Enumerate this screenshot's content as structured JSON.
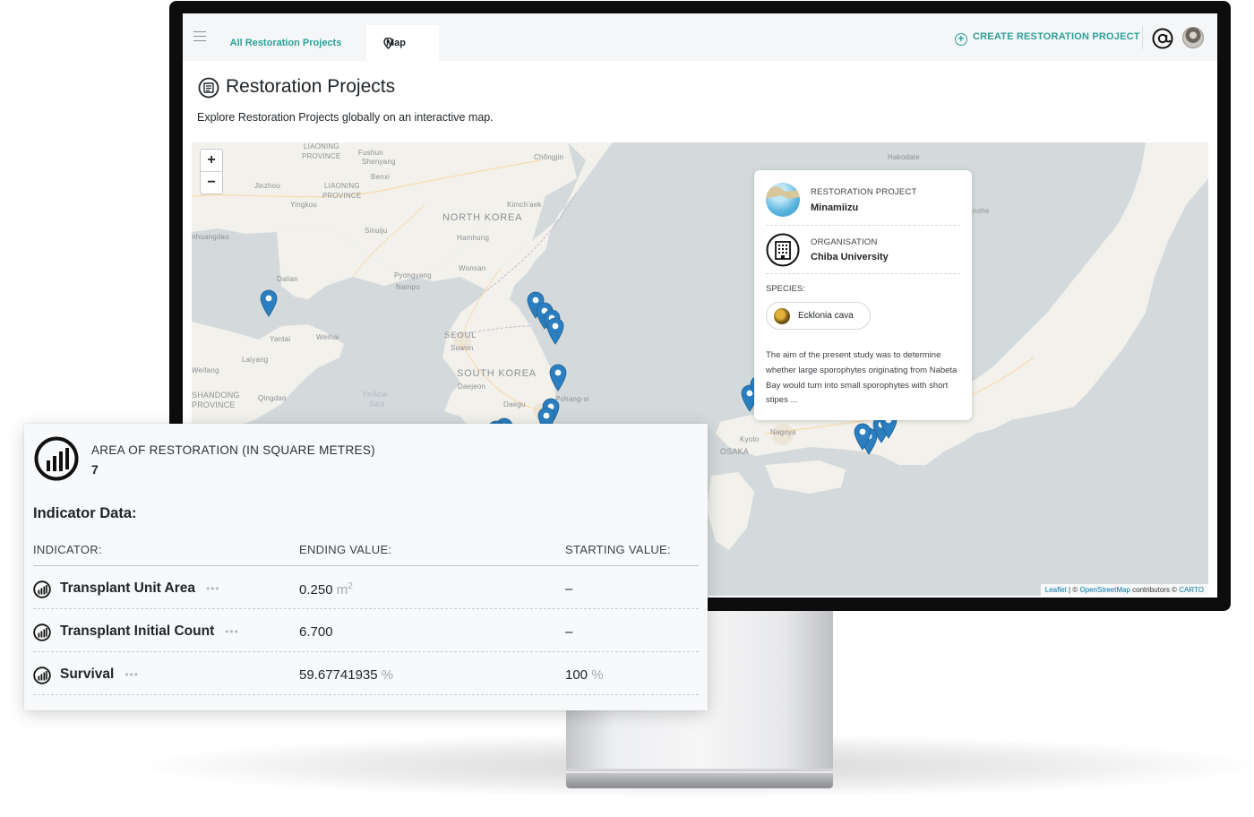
{
  "nav": {
    "tab_all": "All Restoration Projects",
    "tab_map": "Map",
    "create_button": "CREATE RESTORATION PROJECT"
  },
  "page": {
    "title": "Restoration Projects",
    "subtitle": "Explore Restoration Projects globally on an interactive map."
  },
  "map": {
    "zoom_in": "+",
    "zoom_out": "−",
    "labels": {
      "liaoning_1": "LIAONING",
      "province_1": "PROVINCE",
      "fushun": "Fushun",
      "shenyang": "Shenyang",
      "benxi": "Benxi",
      "jinzhou": "Jinzhou",
      "liaoning_2": "LIAONING",
      "province_2": "PROVINCE",
      "yingkou": "Yingkou",
      "chongjin": "Chŏngjin",
      "kimchaek": "Kimch'aek",
      "north_korea": "NORTH KOREA",
      "hamhung": "Hamhung",
      "sinuiju": "Sinuiju",
      "huangdao": "nhuangdao",
      "dalian": "Dalian",
      "pyongyang": "Pyongyang",
      "nampo": "Nampo",
      "wonsan": "Wonsan",
      "seoul": "SEOUL",
      "suwon": "Suwon",
      "yantai": "Yantai",
      "weihai": "Weihai",
      "laiyang": "Laiyang",
      "weifang": "Weifang",
      "south_korea": "SOUTH KOREA",
      "daejeon": "Daejeon",
      "shandong": "SHANDONG",
      "province_3": "PROVINCE",
      "qingdao": "Qingdao",
      "yellow_sea": "Yellow",
      "yellow_sea_2": "Sea",
      "pohang": "Pohang-si",
      "daegu": "Daegu",
      "hakodate": "Hakodate",
      "nohe": "nohe",
      "nagoya": "Nagoya",
      "kyoto": "Kyoto",
      "osaka": "OSAKA"
    },
    "attribution": {
      "leaflet": "Leaflet",
      "sep1": " | © ",
      "osm": "OpenStreetMap",
      "mid": " contributors © ",
      "carto": "CARTO"
    },
    "popup": {
      "project_caption": "RESTORATION PROJECT",
      "project_name": "Minamiizu",
      "org_caption": "ORGANISATION",
      "org_name": "Chiba University",
      "species_caption": "SPECIES:",
      "species_name": "Ecklonia cava",
      "description": "The aim of the present study was to determine whether large sporophytes originating from Nabeta Bay would turn into small sporophytes with short stipes ..."
    },
    "marker_color": "#2b7fc1"
  },
  "card": {
    "metric_caption": "AREA OF RESTORATION (IN SQUARE METRES)",
    "metric_value": "7",
    "heading": "Indicator Data:",
    "columns": {
      "indicator": "INDICATOR:",
      "ending": "ENDING VALUE:",
      "starting": "STARTING VALUE:"
    },
    "rows": [
      {
        "name": "Transplant Unit Area",
        "more": "•••",
        "ending": "0.250",
        "ending_unit": "m",
        "ending_sup": "2",
        "starting": "–",
        "starting_unit": ""
      },
      {
        "name": "Transplant Initial Count",
        "more": "•••",
        "ending": "6.700",
        "ending_unit": "",
        "ending_sup": "",
        "starting": "–",
        "starting_unit": ""
      },
      {
        "name": "Survival",
        "more": "•••",
        "ending": "59.67741935",
        "ending_unit": "%",
        "ending_sup": "",
        "starting": "100",
        "starting_unit": "%"
      }
    ]
  },
  "colors": {
    "accent": "#2aa198",
    "marker": "#2b7fc1",
    "water": "#d4dadc",
    "land": "#f2f1ec"
  }
}
